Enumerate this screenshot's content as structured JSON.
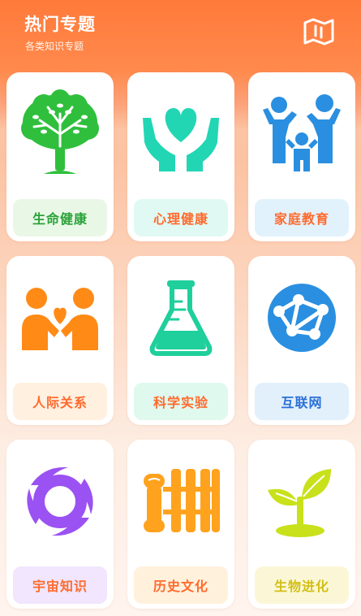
{
  "header": {
    "title": "热门专题",
    "subtitle": "各类知识专题",
    "map_icon": "folded-map-icon"
  },
  "cards": [
    {
      "label": "生命健康",
      "icon": "tree-icon",
      "color": "#2fbf3c",
      "label_bg": "#e9f8e6",
      "label_color": "#2aa23a"
    },
    {
      "label": "心理健康",
      "icon": "hands-heart-icon",
      "color": "#22d6b4",
      "label_bg": "#e0f9f3",
      "label_color": "#ff6a2d"
    },
    {
      "label": "家庭教育",
      "icon": "family-icon",
      "color": "#2a8fe0",
      "label_bg": "#e2f2fc",
      "label_color": "#ff6a2d"
    },
    {
      "label": "人际关系",
      "icon": "people-heart-icon",
      "color": "#ff8a16",
      "label_bg": "#fff0e0",
      "label_color": "#ff6a2d"
    },
    {
      "label": "科学实验",
      "icon": "flask-icon",
      "color": "#1fcf9c",
      "label_bg": "#dff9ef",
      "label_color": "#ff6a2d"
    },
    {
      "label": "互联网",
      "icon": "network-globe-icon",
      "color": "#2a8fe0",
      "label_bg": "#e2f0fc",
      "label_color": "#2a6fd6"
    },
    {
      "label": "宇宙知识",
      "icon": "galaxy-icon",
      "color": "#9b52f2",
      "label_bg": "#f1e6fd",
      "label_color": "#ff6a2d"
    },
    {
      "label": "历史文化",
      "icon": "scroll-bamboo-icon",
      "color": "#ffa21d",
      "label_bg": "#fff1dc",
      "label_color": "#ff6a2d"
    },
    {
      "label": "生物进化",
      "icon": "sprout-icon",
      "color": "#c8e11a",
      "label_bg": "#fbf7d6",
      "label_color": "#d3bf14"
    }
  ]
}
